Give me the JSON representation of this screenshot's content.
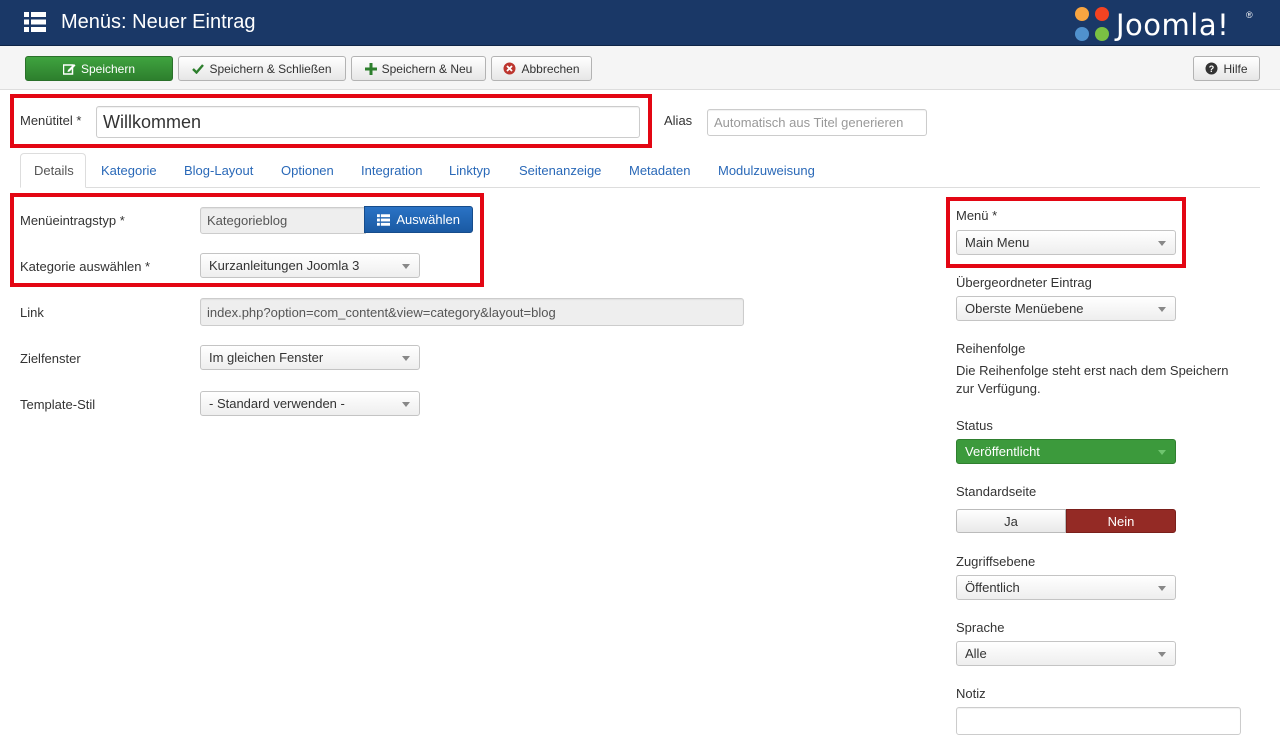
{
  "header": {
    "title": "Menüs: Neuer Eintrag",
    "logo_text": "Joomla!",
    "logo_reg": "®"
  },
  "toolbar": {
    "save": "Speichern",
    "save_close": "Speichern & Schließen",
    "save_new": "Speichern & Neu",
    "cancel": "Abbrechen",
    "help": "Hilfe"
  },
  "title_row": {
    "menu_title_label": "Menütitel *",
    "menu_title_value": "Willkommen",
    "alias_label": "Alias",
    "alias_placeholder": "Automatisch aus Titel generieren"
  },
  "tabs": [
    {
      "label": "Details"
    },
    {
      "label": "Kategorie"
    },
    {
      "label": "Blog-Layout"
    },
    {
      "label": "Optionen"
    },
    {
      "label": "Integration"
    },
    {
      "label": "Linktyp"
    },
    {
      "label": "Seitenanzeige"
    },
    {
      "label": "Metadaten"
    },
    {
      "label": "Modulzuweisung"
    }
  ],
  "details": {
    "item_type_label": "Menüeintragstyp *",
    "item_type_value": "Kategorieblog",
    "select_button": "Auswählen",
    "category_label": "Kategorie auswählen *",
    "category_value": "Kurzanleitungen Joomla 3",
    "link_label": "Link",
    "link_value": "index.php?option=com_content&view=category&layout=blog",
    "target_label": "Zielfenster",
    "target_value": "Im gleichen Fenster",
    "template_label": "Template-Stil",
    "template_value": "- Standard verwenden -"
  },
  "sidebar": {
    "menu_label": "Menü *",
    "menu_value": "Main Menu",
    "parent_label": "Übergeordneter Eintrag",
    "parent_value": "Oberste Menüebene",
    "ordering_label": "Reihenfolge",
    "ordering_text": "Die Reihenfolge steht erst nach dem Speichern zur Verfügung.",
    "status_label": "Status",
    "status_value": "Veröffentlicht",
    "default_label": "Standardseite",
    "default_yes": "Ja",
    "default_no": "Nein",
    "access_label": "Zugriffsebene",
    "access_value": "Öffentlich",
    "language_label": "Sprache",
    "language_value": "Alle",
    "note_label": "Notiz"
  },
  "colors": {
    "header_bg": "#1a3867",
    "success": "#3c9a3c",
    "danger": "#942a25",
    "highlight": "#e30613",
    "link": "#2a69b8"
  }
}
